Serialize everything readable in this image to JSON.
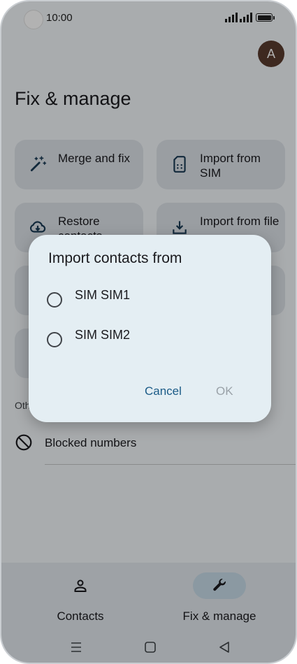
{
  "status_bar": {
    "time": "10:00"
  },
  "account": {
    "avatar_letter": "A"
  },
  "page": {
    "title": "Fix & manage"
  },
  "cards": [
    {
      "label": "Merge and fix",
      "icon": "magic-wand-icon"
    },
    {
      "label": "Import from SIM",
      "icon": "sim-card-icon"
    },
    {
      "label": "Restore contacts",
      "icon": "cloud-download-icon"
    },
    {
      "label": "Import from file",
      "icon": "download-icon"
    }
  ],
  "other_section": {
    "label": "Oth",
    "blocked": {
      "label": "Blocked numbers",
      "icon": "block-icon"
    }
  },
  "bottom_nav": {
    "contacts": {
      "label": "Contacts",
      "icon": "person-icon"
    },
    "fix_manage": {
      "label": "Fix & manage",
      "icon": "wrench-icon",
      "active": true
    }
  },
  "dialog": {
    "title": "Import contacts from",
    "options": [
      {
        "label": "SIM SIM1",
        "selected": false
      },
      {
        "label": "SIM SIM2",
        "selected": false
      }
    ],
    "cancel_label": "Cancel",
    "ok_label": "OK",
    "ok_enabled": false
  },
  "colors": {
    "accent": "#1b5b87",
    "avatar": "#5a3b2e",
    "dialog_bg": "#e4eef3"
  }
}
